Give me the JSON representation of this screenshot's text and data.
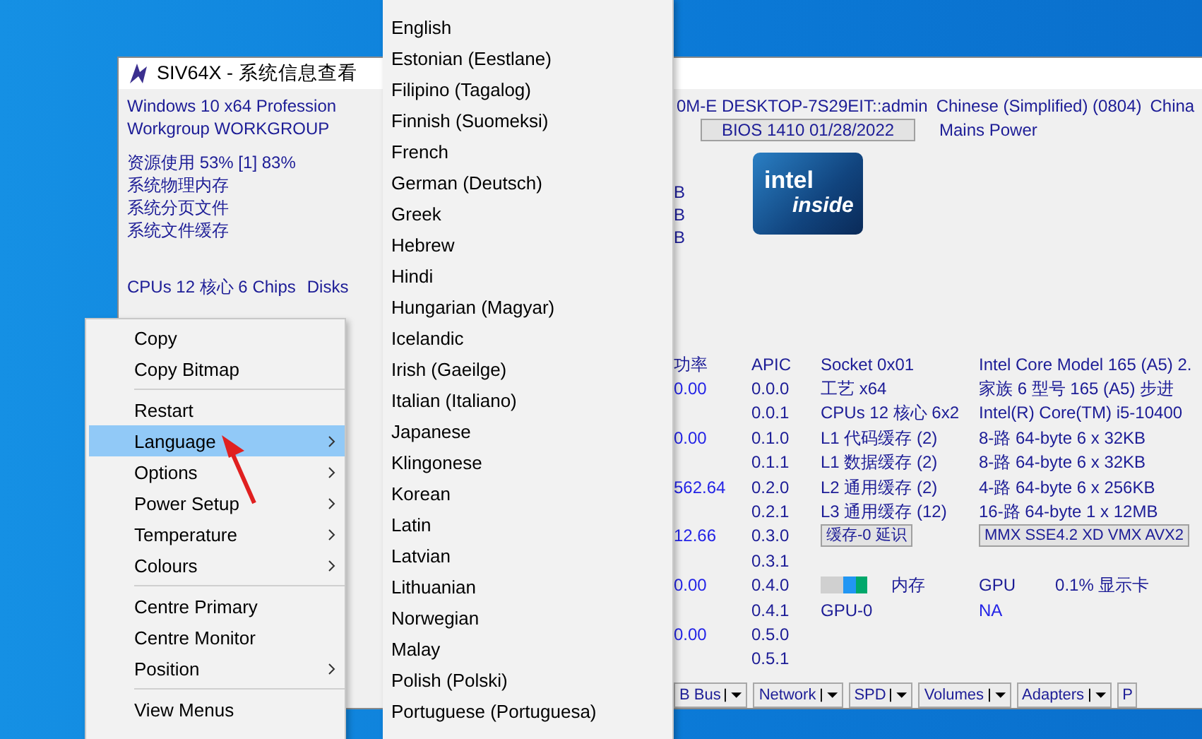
{
  "window": {
    "title": "SIV64X - 系统信息查看"
  },
  "summary_lines": [
    "Windows 10 x64 Profession",
    "Workgroup WORKGROUP"
  ],
  "resources": [
    "资源使用 53% [1] 83%",
    "系统物理内存",
    "系统分页文件",
    "系统文件缓存"
  ],
  "cpu_line": [
    "CPUs 12 核心 6 Chips",
    "Disks"
  ],
  "system_line": [
    "0M-E  DESKTOP-7S29EIT::admin",
    "Chinese (Simplified) (0804)",
    "China"
  ],
  "bios": "BIOS 1410 01/28/2022",
  "power_source": "Mains Power",
  "memory_units": [
    "B",
    "B",
    "B"
  ],
  "cpu_badge": {
    "brand": "intel",
    "tagline": "inside"
  },
  "cpu_table": [
    {
      "power": {
        "text": "功率",
        "kind": "label"
      },
      "apic": "APIC",
      "left": [
        {
          "kind": "label",
          "text": "Socket 0x01"
        }
      ],
      "right": [
        {
          "kind": "label",
          "text": "Intel Core Model 165 (A5) 2."
        }
      ]
    },
    {
      "power": {
        "text": "0.00",
        "kind": "value"
      },
      "apic": "0.0.0",
      "left": [
        {
          "kind": "label",
          "text": "工艺  x64"
        }
      ],
      "right": [
        {
          "kind": "label",
          "text": "家族 6  型号 165 (A5)  步进"
        }
      ]
    },
    {
      "apic": "0.0.1",
      "left": [
        {
          "kind": "label",
          "text": "CPUs 12 核心 6x2"
        }
      ],
      "right": [
        {
          "kind": "label",
          "text": "Intel(R) Core(TM) i5-10400"
        }
      ]
    },
    {
      "power": {
        "text": "0.00",
        "kind": "value"
      },
      "apic": "0.1.0",
      "left": [
        {
          "kind": "label",
          "text": "L1 代码缓存 (2)"
        }
      ],
      "right": [
        {
          "kind": "label",
          "text": "8-路 64-byte  6 x 32KB"
        }
      ]
    },
    {
      "apic": "0.1.1",
      "left": [
        {
          "kind": "label",
          "text": "L1 数据缓存 (2)"
        }
      ],
      "right": [
        {
          "kind": "label",
          "text": "8-路 64-byte  6 x 32KB"
        }
      ]
    },
    {
      "power": {
        "text": "562.64",
        "kind": "value"
      },
      "apic": "0.2.0",
      "left": [
        {
          "kind": "label",
          "text": "L2 通用缓存 (2)"
        }
      ],
      "right": [
        {
          "kind": "label",
          "text": "4-路 64-byte  6 x 256KB"
        }
      ]
    },
    {
      "apic": "0.2.1",
      "left": [
        {
          "kind": "label",
          "text": "L3 通用缓存 (12)"
        }
      ],
      "right": [
        {
          "kind": "label",
          "text": "16-路 64-byte  1 x 12MB"
        }
      ]
    },
    {
      "power": {
        "text": "12.66",
        "kind": "value"
      },
      "apic": "0.3.0",
      "left": [
        {
          "kind": "button",
          "text": "缓存-0 延识"
        }
      ],
      "right": [
        {
          "kind": "button",
          "text": "MMX SSE4.2 XD VMX AVX2"
        }
      ]
    },
    {
      "apic": "0.3.1"
    },
    {
      "power": {
        "text": "0.00",
        "kind": "value"
      },
      "apic": "0.4.0",
      "left": [
        {
          "kind": "meter"
        },
        {
          "kind": "label",
          "text": "内存"
        }
      ],
      "right": [
        {
          "kind": "label",
          "text": "GPU"
        },
        {
          "kind": "label",
          "text": "0.1% 显示卡"
        }
      ]
    },
    {
      "apic": "0.4.1",
      "left": [
        {
          "kind": "label",
          "text": "GPU-0"
        }
      ],
      "right": [
        {
          "kind": "value",
          "text": "NA"
        }
      ]
    },
    {
      "power": {
        "text": "0.00",
        "kind": "value"
      },
      "apic": "0.5.0"
    },
    {
      "apic": "0.5.1"
    }
  ],
  "toolbar": [
    {
      "label": "B Bus",
      "dropdown": true
    },
    {
      "label": "Network",
      "dropdown": true
    },
    {
      "label": "SPD",
      "dropdown": true
    },
    {
      "label": "Volumes",
      "dropdown": true
    },
    {
      "label": "Adapters",
      "dropdown": true
    },
    {
      "label": "P",
      "dropdown": false
    }
  ],
  "context_menu": [
    {
      "kind": "item",
      "label": "Copy",
      "selected": false,
      "submenu": false
    },
    {
      "kind": "item",
      "label": "Copy Bitmap",
      "selected": false,
      "submenu": false
    },
    {
      "kind": "separator"
    },
    {
      "kind": "item",
      "label": "Restart",
      "selected": false,
      "submenu": false
    },
    {
      "kind": "item",
      "label": "Language",
      "selected": true,
      "submenu": true
    },
    {
      "kind": "item",
      "label": "Options",
      "selected": false,
      "submenu": true
    },
    {
      "kind": "item",
      "label": "Power Setup",
      "selected": false,
      "submenu": true
    },
    {
      "kind": "item",
      "label": "Temperature",
      "selected": false,
      "submenu": true
    },
    {
      "kind": "item",
      "label": "Colours",
      "selected": false,
      "submenu": true
    },
    {
      "kind": "separator"
    },
    {
      "kind": "item",
      "label": "Centre Primary",
      "selected": false,
      "submenu": false
    },
    {
      "kind": "item",
      "label": "Centre Monitor",
      "selected": false,
      "submenu": false
    },
    {
      "kind": "item",
      "label": "Position",
      "selected": false,
      "submenu": true
    },
    {
      "kind": "separator"
    },
    {
      "kind": "item",
      "label": "View Menus",
      "selected": false,
      "submenu": false
    }
  ],
  "language_menu": [
    "English",
    "Estonian (Eestlane)",
    "Filipino (Tagalog)",
    "Finnish (Suomeksi)",
    "French",
    "German (Deutsch)",
    "Greek",
    "Hebrew",
    "Hindi",
    "Hungarian (Magyar)",
    "Icelandic",
    "Irish (Gaeilge)",
    "Italian (Italiano)",
    "Japanese",
    "Klingonese",
    "Korean",
    "Latin",
    "Latvian",
    "Lithuanian",
    "Norwegian",
    "Malay",
    "Polish (Polski)",
    "Portuguese (Portuguesa)"
  ]
}
